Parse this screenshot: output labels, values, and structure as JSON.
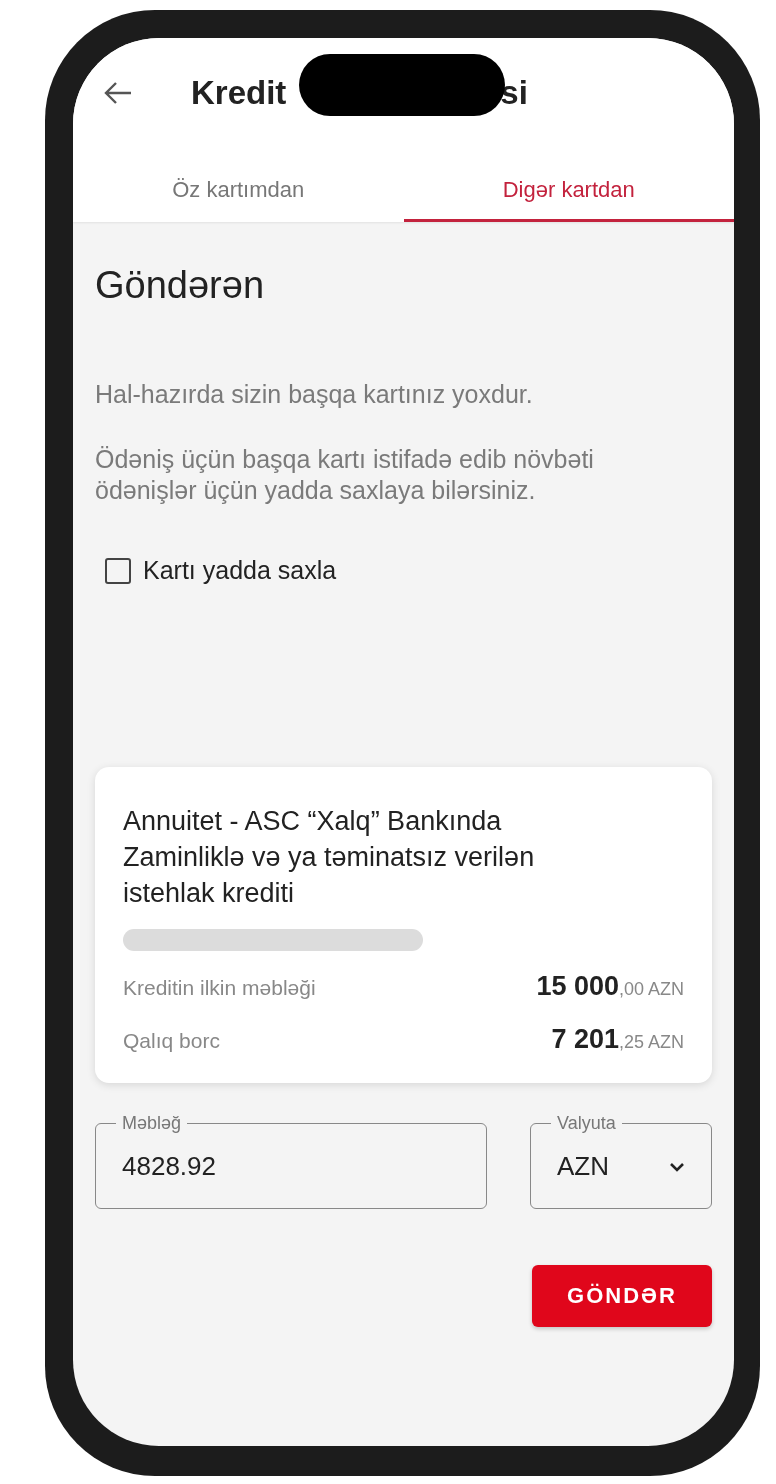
{
  "header": {
    "title_start": "Kredit",
    "title_end": "si"
  },
  "tabs": [
    {
      "label": "Öz kartımdan",
      "selected": false
    },
    {
      "label": "Digər kartdan",
      "selected": true
    }
  ],
  "heading": "Göndərən",
  "messages": [
    "Hal-hazırda sizin başqa kartınız yoxdur.",
    "Ödəniş üçün başqa kartı istifadə edib növbəti ödənişlər üçün yadda saxlaya bilərsiniz."
  ],
  "save_card": {
    "label": "Kartı yadda saxla",
    "checked": false
  },
  "loan": {
    "title": "Annuitet - ASC “Xalq” Bankında Zaminliklə və ya təminatsız verilən istehlak krediti",
    "rows": [
      {
        "label": "Kreditin ilkin məbləği",
        "whole": "15 000",
        "fraction": ",00",
        "currency": "AZN"
      },
      {
        "label": "Qalıq borc",
        "whole": "7 201",
        "fraction": ",25",
        "currency": "AZN"
      }
    ]
  },
  "amount": {
    "label": "Məbləğ",
    "value": "4828.92"
  },
  "currency": {
    "label": "Valyuta",
    "value": "AZN"
  },
  "submit": "GÖNDƏR"
}
